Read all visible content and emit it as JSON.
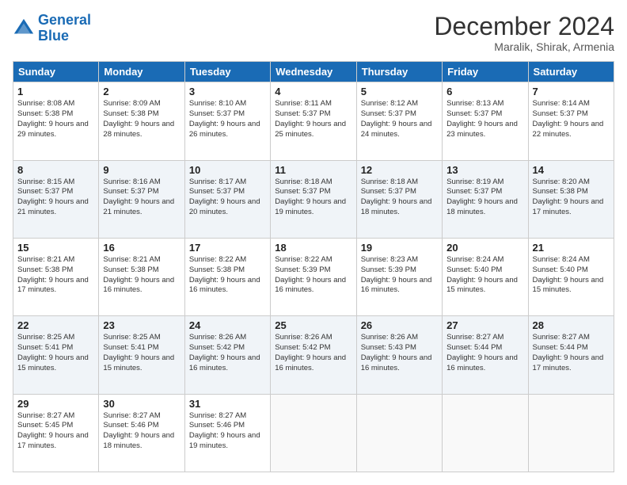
{
  "logo": {
    "line1": "General",
    "line2": "Blue"
  },
  "title": "December 2024",
  "subtitle": "Maralik, Shirak, Armenia",
  "days": [
    "Sunday",
    "Monday",
    "Tuesday",
    "Wednesday",
    "Thursday",
    "Friday",
    "Saturday"
  ],
  "weeks": [
    [
      {
        "day": "1",
        "sunrise": "8:08 AM",
        "sunset": "5:38 PM",
        "daylight": "9 hours and 29 minutes."
      },
      {
        "day": "2",
        "sunrise": "8:09 AM",
        "sunset": "5:38 PM",
        "daylight": "9 hours and 28 minutes."
      },
      {
        "day": "3",
        "sunrise": "8:10 AM",
        "sunset": "5:37 PM",
        "daylight": "9 hours and 26 minutes."
      },
      {
        "day": "4",
        "sunrise": "8:11 AM",
        "sunset": "5:37 PM",
        "daylight": "9 hours and 25 minutes."
      },
      {
        "day": "5",
        "sunrise": "8:12 AM",
        "sunset": "5:37 PM",
        "daylight": "9 hours and 24 minutes."
      },
      {
        "day": "6",
        "sunrise": "8:13 AM",
        "sunset": "5:37 PM",
        "daylight": "9 hours and 23 minutes."
      },
      {
        "day": "7",
        "sunrise": "8:14 AM",
        "sunset": "5:37 PM",
        "daylight": "9 hours and 22 minutes."
      }
    ],
    [
      {
        "day": "8",
        "sunrise": "8:15 AM",
        "sunset": "5:37 PM",
        "daylight": "9 hours and 21 minutes."
      },
      {
        "day": "9",
        "sunrise": "8:16 AM",
        "sunset": "5:37 PM",
        "daylight": "9 hours and 21 minutes."
      },
      {
        "day": "10",
        "sunrise": "8:17 AM",
        "sunset": "5:37 PM",
        "daylight": "9 hours and 20 minutes."
      },
      {
        "day": "11",
        "sunrise": "8:18 AM",
        "sunset": "5:37 PM",
        "daylight": "9 hours and 19 minutes."
      },
      {
        "day": "12",
        "sunrise": "8:18 AM",
        "sunset": "5:37 PM",
        "daylight": "9 hours and 18 minutes."
      },
      {
        "day": "13",
        "sunrise": "8:19 AM",
        "sunset": "5:37 PM",
        "daylight": "9 hours and 18 minutes."
      },
      {
        "day": "14",
        "sunrise": "8:20 AM",
        "sunset": "5:38 PM",
        "daylight": "9 hours and 17 minutes."
      }
    ],
    [
      {
        "day": "15",
        "sunrise": "8:21 AM",
        "sunset": "5:38 PM",
        "daylight": "9 hours and 17 minutes."
      },
      {
        "day": "16",
        "sunrise": "8:21 AM",
        "sunset": "5:38 PM",
        "daylight": "9 hours and 16 minutes."
      },
      {
        "day": "17",
        "sunrise": "8:22 AM",
        "sunset": "5:38 PM",
        "daylight": "9 hours and 16 minutes."
      },
      {
        "day": "18",
        "sunrise": "8:22 AM",
        "sunset": "5:39 PM",
        "daylight": "9 hours and 16 minutes."
      },
      {
        "day": "19",
        "sunrise": "8:23 AM",
        "sunset": "5:39 PM",
        "daylight": "9 hours and 16 minutes."
      },
      {
        "day": "20",
        "sunrise": "8:24 AM",
        "sunset": "5:40 PM",
        "daylight": "9 hours and 15 minutes."
      },
      {
        "day": "21",
        "sunrise": "8:24 AM",
        "sunset": "5:40 PM",
        "daylight": "9 hours and 15 minutes."
      }
    ],
    [
      {
        "day": "22",
        "sunrise": "8:25 AM",
        "sunset": "5:41 PM",
        "daylight": "9 hours and 15 minutes."
      },
      {
        "day": "23",
        "sunrise": "8:25 AM",
        "sunset": "5:41 PM",
        "daylight": "9 hours and 15 minutes."
      },
      {
        "day": "24",
        "sunrise": "8:26 AM",
        "sunset": "5:42 PM",
        "daylight": "9 hours and 16 minutes."
      },
      {
        "day": "25",
        "sunrise": "8:26 AM",
        "sunset": "5:42 PM",
        "daylight": "9 hours and 16 minutes."
      },
      {
        "day": "26",
        "sunrise": "8:26 AM",
        "sunset": "5:43 PM",
        "daylight": "9 hours and 16 minutes."
      },
      {
        "day": "27",
        "sunrise": "8:27 AM",
        "sunset": "5:44 PM",
        "daylight": "9 hours and 16 minutes."
      },
      {
        "day": "28",
        "sunrise": "8:27 AM",
        "sunset": "5:44 PM",
        "daylight": "9 hours and 17 minutes."
      }
    ],
    [
      {
        "day": "29",
        "sunrise": "8:27 AM",
        "sunset": "5:45 PM",
        "daylight": "9 hours and 17 minutes."
      },
      {
        "day": "30",
        "sunrise": "8:27 AM",
        "sunset": "5:46 PM",
        "daylight": "9 hours and 18 minutes."
      },
      {
        "day": "31",
        "sunrise": "8:27 AM",
        "sunset": "5:46 PM",
        "daylight": "9 hours and 19 minutes."
      },
      null,
      null,
      null,
      null
    ]
  ]
}
